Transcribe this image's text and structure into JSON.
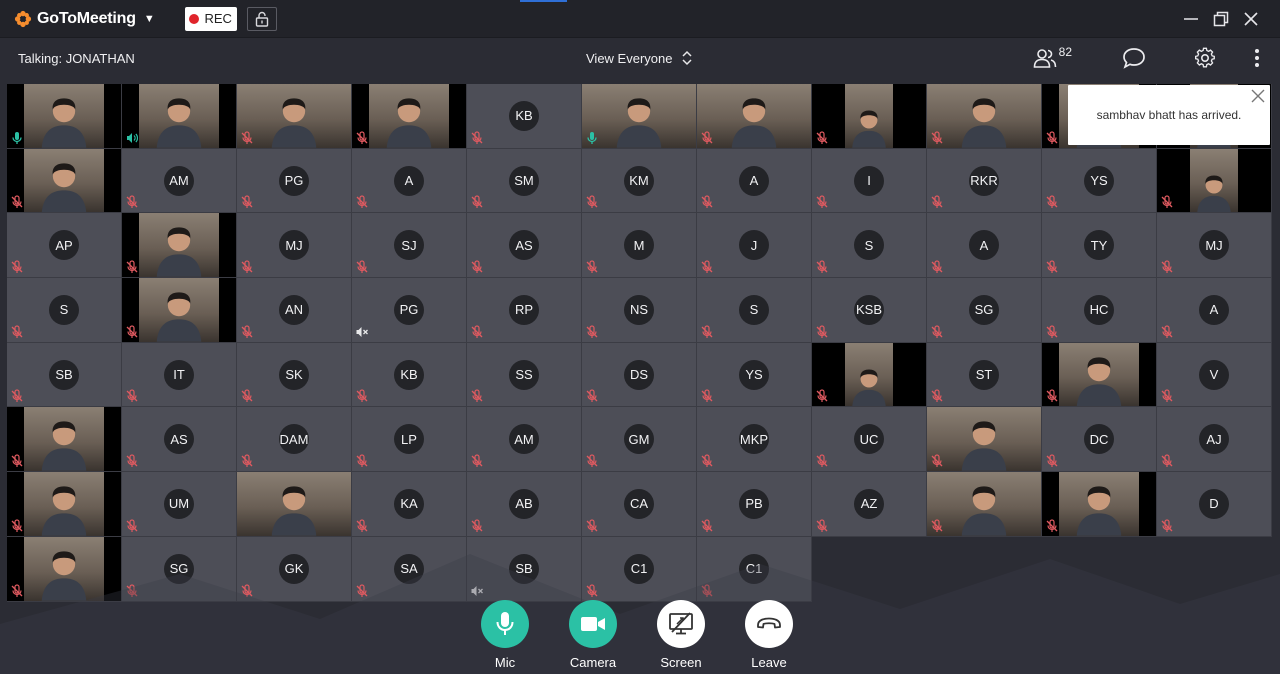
{
  "app": {
    "brand": "GoToMeeting",
    "rec_label": "REC",
    "accent": "#f68d2e",
    "rec_color": "#e0242b"
  },
  "toolbar": {
    "talking": "Talking: JONATHAN",
    "view_label": "View Everyone",
    "people_count": "82"
  },
  "notification": {
    "message": "sambhav bhatt has arrived."
  },
  "controls": {
    "mic": "Mic",
    "camera": "Camera",
    "screen": "Screen",
    "leave": "Leave",
    "active_color": "#2bc1a5"
  },
  "participants": [
    {
      "t": "video",
      "mic": "on"
    },
    {
      "t": "video",
      "mic": "speaking"
    },
    {
      "t": "video",
      "mic": "off"
    },
    {
      "t": "video",
      "mic": "off"
    },
    {
      "t": "avatar",
      "i": "KB",
      "mic": "off"
    },
    {
      "t": "video",
      "mic": "on"
    },
    {
      "t": "video",
      "mic": "off"
    },
    {
      "t": "video",
      "mic": "off"
    },
    {
      "t": "video",
      "mic": "off"
    },
    {
      "t": "video",
      "mic": "off"
    },
    {
      "t": "video",
      "mic": "off"
    },
    {
      "t": "video",
      "mic": "off"
    },
    {
      "t": "avatar",
      "i": "AM",
      "mic": "off"
    },
    {
      "t": "avatar",
      "i": "PG",
      "mic": "off"
    },
    {
      "t": "avatar",
      "i": "A",
      "mic": "off"
    },
    {
      "t": "avatar",
      "i": "SM",
      "mic": "off"
    },
    {
      "t": "avatar",
      "i": "KM",
      "mic": "off"
    },
    {
      "t": "avatar",
      "i": "A",
      "mic": "off"
    },
    {
      "t": "avatar",
      "i": "I",
      "mic": "off"
    },
    {
      "t": "avatar",
      "i": "RKR",
      "mic": "off"
    },
    {
      "t": "avatar",
      "i": "YS",
      "mic": "off"
    },
    {
      "t": "video",
      "mic": "off"
    },
    {
      "t": "avatar",
      "i": "AP",
      "mic": "off"
    },
    {
      "t": "video",
      "mic": "off"
    },
    {
      "t": "avatar",
      "i": "MJ",
      "mic": "off"
    },
    {
      "t": "avatar",
      "i": "SJ",
      "mic": "off"
    },
    {
      "t": "avatar",
      "i": "AS",
      "mic": "off"
    },
    {
      "t": "avatar",
      "i": "M",
      "mic": "off"
    },
    {
      "t": "avatar",
      "i": "J",
      "mic": "off"
    },
    {
      "t": "avatar",
      "i": "S",
      "mic": "off"
    },
    {
      "t": "avatar",
      "i": "A",
      "mic": "off"
    },
    {
      "t": "avatar",
      "i": "TY",
      "mic": "off"
    },
    {
      "t": "avatar",
      "i": "MJ",
      "mic": "off"
    },
    {
      "t": "avatar",
      "i": "S",
      "mic": "off"
    },
    {
      "t": "video",
      "mic": "off"
    },
    {
      "t": "avatar",
      "i": "AN",
      "mic": "off"
    },
    {
      "t": "avatar",
      "i": "PG",
      "mic": "speaker-off"
    },
    {
      "t": "avatar",
      "i": "RP",
      "mic": "off"
    },
    {
      "t": "avatar",
      "i": "NS",
      "mic": "off"
    },
    {
      "t": "avatar",
      "i": "S",
      "mic": "off"
    },
    {
      "t": "avatar",
      "i": "KSB",
      "mic": "off"
    },
    {
      "t": "avatar",
      "i": "SG",
      "mic": "off"
    },
    {
      "t": "avatar",
      "i": "HC",
      "mic": "off"
    },
    {
      "t": "avatar",
      "i": "A",
      "mic": "off"
    },
    {
      "t": "avatar",
      "i": "SB",
      "mic": "off"
    },
    {
      "t": "avatar",
      "i": "IT",
      "mic": "off"
    },
    {
      "t": "avatar",
      "i": "SK",
      "mic": "off"
    },
    {
      "t": "avatar",
      "i": "KB",
      "mic": "off"
    },
    {
      "t": "avatar",
      "i": "SS",
      "mic": "off"
    },
    {
      "t": "avatar",
      "i": "DS",
      "mic": "off"
    },
    {
      "t": "avatar",
      "i": "YS",
      "mic": "off"
    },
    {
      "t": "video",
      "mic": "off"
    },
    {
      "t": "avatar",
      "i": "ST",
      "mic": "off"
    },
    {
      "t": "video",
      "mic": "off"
    },
    {
      "t": "avatar",
      "i": "V",
      "mic": "off"
    },
    {
      "t": "video",
      "mic": "off"
    },
    {
      "t": "avatar",
      "i": "AS",
      "mic": "off"
    },
    {
      "t": "avatar",
      "i": "DAM",
      "mic": "off"
    },
    {
      "t": "avatar",
      "i": "LP",
      "mic": "off"
    },
    {
      "t": "avatar",
      "i": "AM",
      "mic": "off"
    },
    {
      "t": "avatar",
      "i": "GM",
      "mic": "off"
    },
    {
      "t": "avatar",
      "i": "MKP",
      "mic": "off"
    },
    {
      "t": "avatar",
      "i": "UC",
      "mic": "off"
    },
    {
      "t": "video",
      "mic": "off"
    },
    {
      "t": "avatar",
      "i": "DC",
      "mic": "off"
    },
    {
      "t": "avatar",
      "i": "AJ",
      "mic": "off"
    },
    {
      "t": "video",
      "mic": "off"
    },
    {
      "t": "avatar",
      "i": "UM",
      "mic": "off"
    },
    {
      "t": "video",
      "mic": "none"
    },
    {
      "t": "avatar",
      "i": "KA",
      "mic": "off"
    },
    {
      "t": "avatar",
      "i": "AB",
      "mic": "off"
    },
    {
      "t": "avatar",
      "i": "CA",
      "mic": "off"
    },
    {
      "t": "avatar",
      "i": "PB",
      "mic": "off"
    },
    {
      "t": "avatar",
      "i": "AZ",
      "mic": "off"
    },
    {
      "t": "video",
      "mic": "off"
    },
    {
      "t": "video",
      "mic": "off"
    },
    {
      "t": "avatar",
      "i": "D",
      "mic": "off"
    },
    {
      "t": "video",
      "mic": "off"
    },
    {
      "t": "avatar",
      "i": "SG",
      "mic": "off"
    },
    {
      "t": "avatar",
      "i": "GK",
      "mic": "off"
    },
    {
      "t": "avatar",
      "i": "SA",
      "mic": "off"
    },
    {
      "t": "avatar",
      "i": "SB",
      "mic": "speaker-off"
    },
    {
      "t": "avatar",
      "i": "C1",
      "mic": "off"
    },
    {
      "t": "avatar",
      "i": "C1",
      "mic": "off"
    }
  ]
}
